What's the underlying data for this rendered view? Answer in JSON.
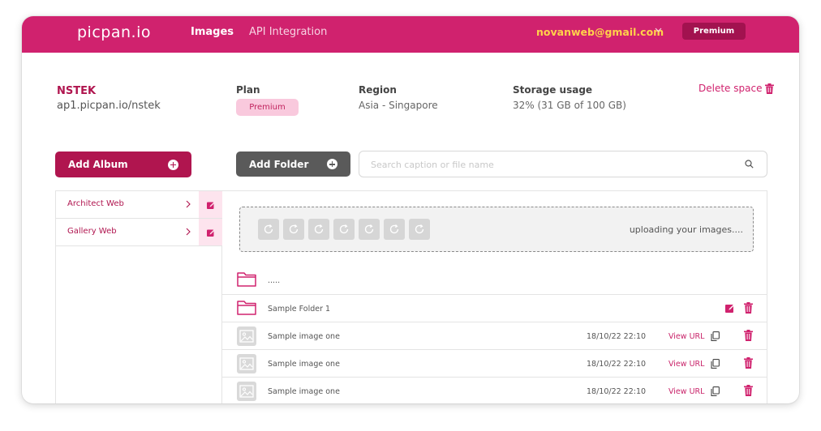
{
  "header": {
    "logo": "picpan.io",
    "nav": [
      {
        "label": "Images",
        "active": true
      },
      {
        "label": "API Integration",
        "active": false
      }
    ],
    "user_email": "novanweb@gmail.com",
    "plan_button": "Premium",
    "bar_color": "#d0226e"
  },
  "space": {
    "name": "NSTEK",
    "url": "ap1.picpan.io/nstek",
    "plan_label": "Plan",
    "plan_value": "Premium",
    "region_label": "Region",
    "region_value": "Asia - Singapore",
    "storage_label": "Storage usage",
    "storage_value": "32% (31 GB of 100 GB)",
    "delete_label": "Delete space"
  },
  "toolbar": {
    "add_album": "Add Album",
    "add_folder": "Add Folder",
    "search_placeholder": "Search caption or file name"
  },
  "albums": [
    {
      "name": "Architect Web"
    },
    {
      "name": "Gallery Web"
    }
  ],
  "upload": {
    "status": "uploading your images...."
  },
  "files": {
    "parent_label": ".....",
    "rows": [
      {
        "type": "folder",
        "name": "Sample Folder 1"
      },
      {
        "type": "image",
        "name": "Sample image one",
        "date": "18/10/22 22:10",
        "action": "View URL"
      },
      {
        "type": "image",
        "name": "Sample image one",
        "date": "18/10/22 22:10",
        "action": "View URL"
      },
      {
        "type": "image",
        "name": "Sample image one",
        "date": "18/10/22 22:10",
        "action": "View URL"
      }
    ]
  },
  "colors": {
    "brand": "#d0226e",
    "brand_dark": "#b0154f",
    "email": "#ffd24a",
    "neutral_button": "#5a5a5a"
  }
}
